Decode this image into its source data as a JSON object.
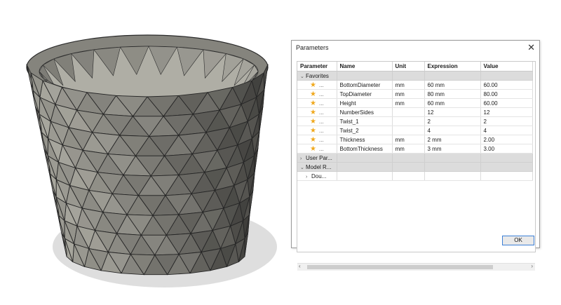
{
  "viewport": {
    "model_color": "#8c8b84",
    "shadow_color": "#dedede"
  },
  "dialog": {
    "title": "Parameters",
    "close_glyph": "✕",
    "columns": [
      "Parameter",
      "Name",
      "Unit",
      "Expression",
      "Value"
    ],
    "groups": {
      "favorites": {
        "label": "Favorites",
        "caret": "⌄"
      },
      "user_params": {
        "label": "User Par...",
        "caret": "›"
      },
      "model_params": {
        "label": "Model R...",
        "caret": "⌄"
      },
      "model_child": {
        "label": "Dou...",
        "caret": "›"
      }
    },
    "favorites_rows": [
      {
        "name": "BottomDiameter",
        "unit": "mm",
        "expression": "60 mm",
        "value": "60.00"
      },
      {
        "name": "TopDiameter",
        "unit": "mm",
        "expression": "80 mm",
        "value": "80.00"
      },
      {
        "name": "Height",
        "unit": "mm",
        "expression": "60 mm",
        "value": "60.00"
      },
      {
        "name": "NumberSides",
        "unit": "",
        "expression": "12",
        "value": "12"
      },
      {
        "name": "Twist_1",
        "unit": "",
        "expression": "2",
        "value": "2"
      },
      {
        "name": "Twist_2",
        "unit": "",
        "expression": "4",
        "value": "4"
      },
      {
        "name": "Thickness",
        "unit": "mm",
        "expression": "2 mm",
        "value": "2.00"
      },
      {
        "name": "BottomThickness",
        "unit": "mm",
        "expression": "3 mm",
        "value": "3.00"
      }
    ],
    "row_dots": "...",
    "star_icon": "★",
    "scroll_left": "‹",
    "scroll_right": "›",
    "ok_label": "OK"
  }
}
